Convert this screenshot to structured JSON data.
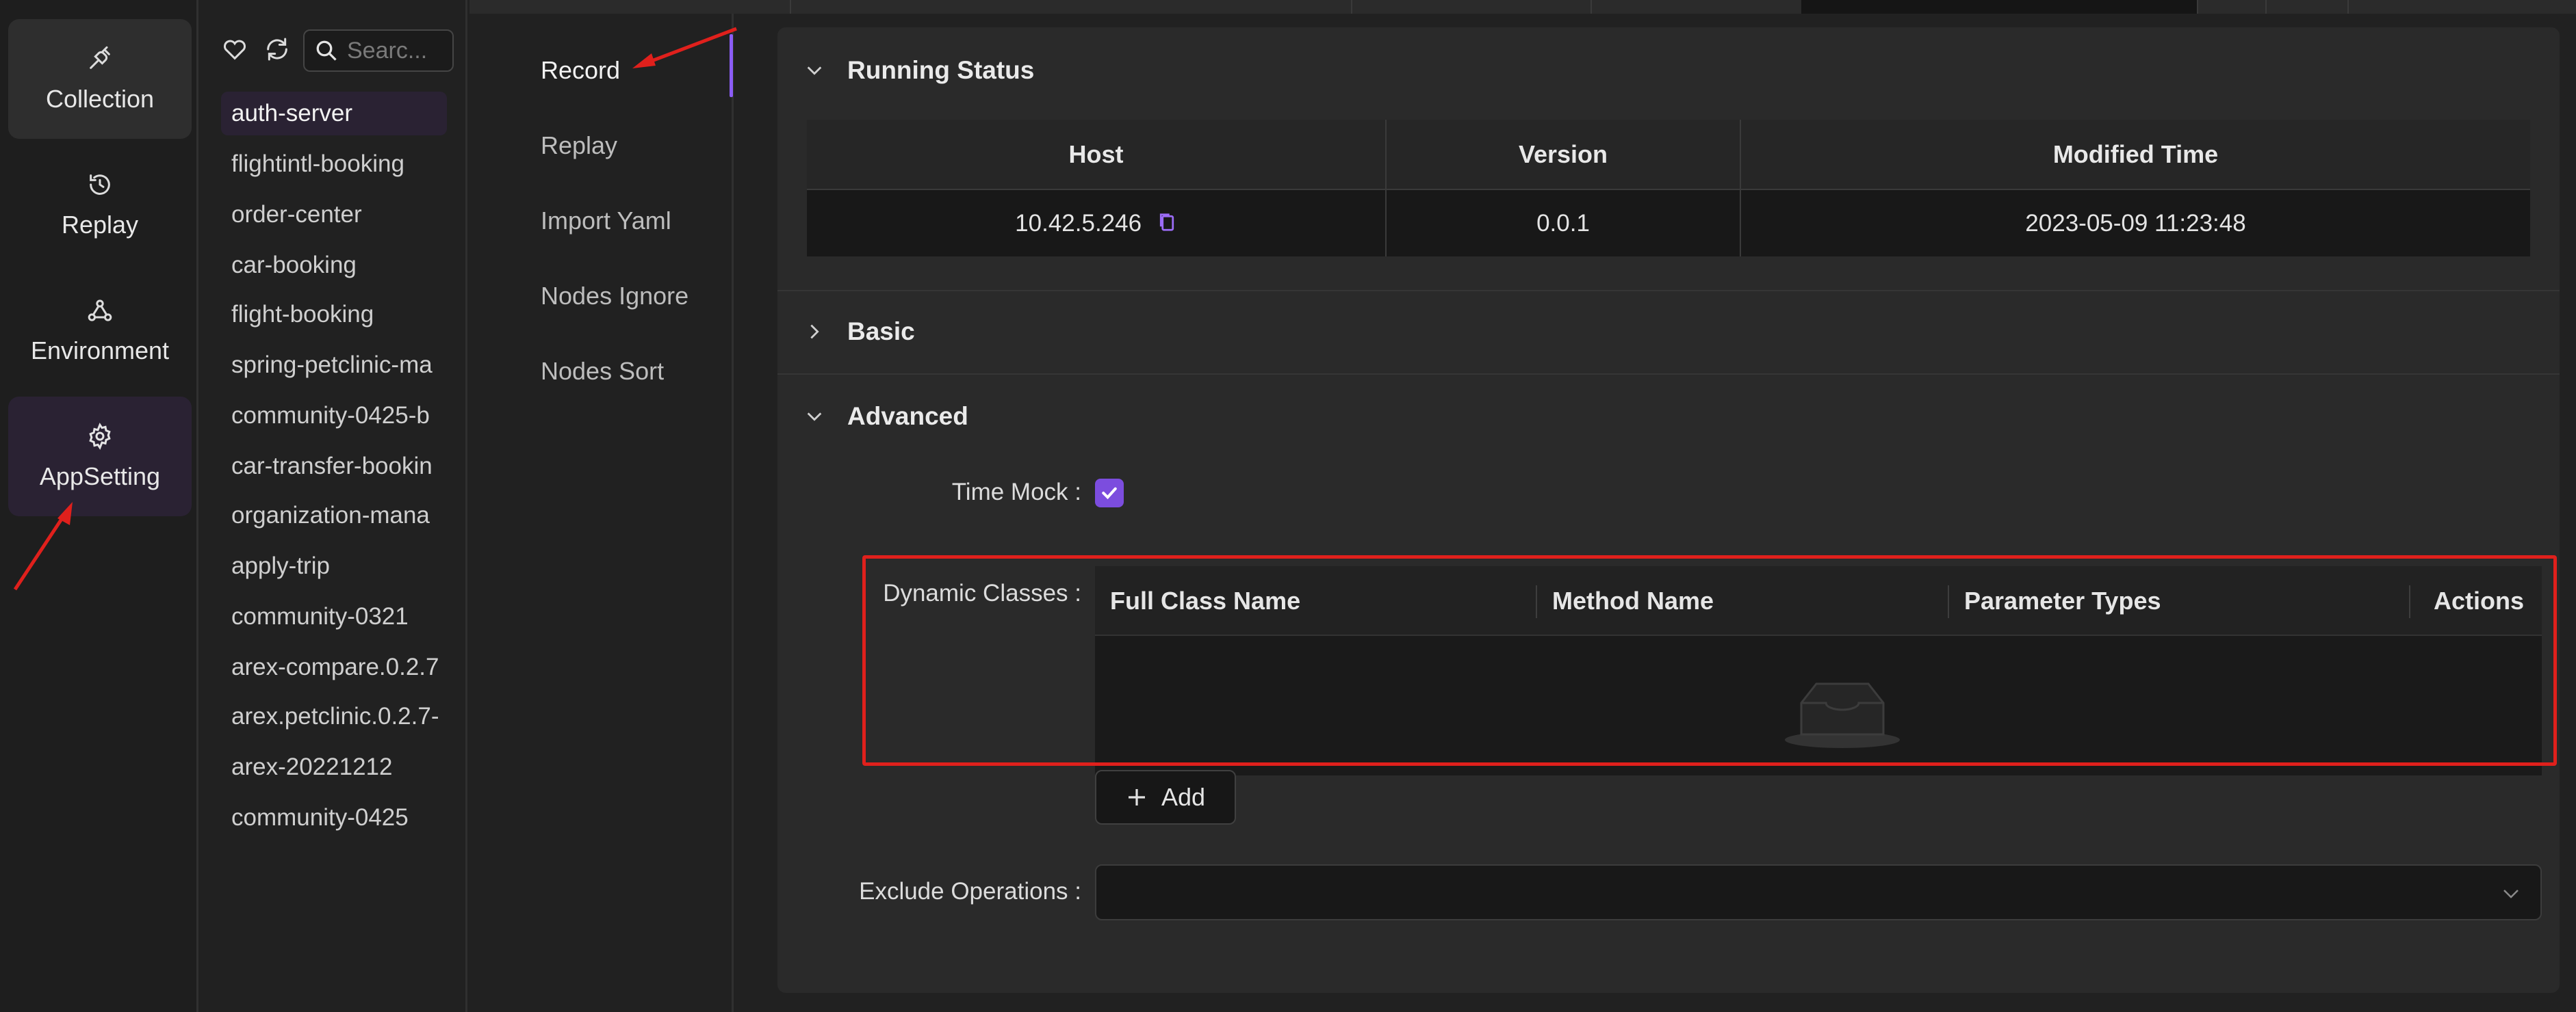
{
  "nav": {
    "items": [
      {
        "label": "Collection",
        "icon": "collection-icon"
      },
      {
        "label": "Replay",
        "icon": "replay-icon"
      },
      {
        "label": "Environment",
        "icon": "environment-icon"
      },
      {
        "label": "AppSetting",
        "icon": "gear-icon"
      }
    ]
  },
  "applist": {
    "search_placeholder": "Searc...",
    "items": [
      "auth-server",
      "flightintl-booking",
      "order-center",
      "car-booking",
      "flight-booking",
      "spring-petclinic-ma",
      "community-0425-b",
      "car-transfer-bookin",
      "organization-mana",
      "apply-trip",
      "community-0321",
      "arex-compare.0.2.7",
      "arex.petclinic.0.2.7-",
      "arex-20221212",
      "community-0425"
    ],
    "selected_index": 0
  },
  "settings_menu": {
    "items": [
      "Record",
      "Replay",
      "Import Yaml",
      "Nodes Ignore",
      "Nodes Sort"
    ],
    "selected_index": 0
  },
  "running_status": {
    "title": "Running Status",
    "columns": [
      "Host",
      "Version",
      "Modified Time"
    ],
    "row": {
      "host": "10.42.5.246",
      "version": "0.0.1",
      "modified_time": "2023-05-09 11:23:48"
    }
  },
  "basic": {
    "title": "Basic"
  },
  "advanced": {
    "title": "Advanced",
    "time_mock_label": "Time Mock",
    "time_mock_checked": true,
    "dynamic_classes_label": "Dynamic Classes",
    "dynamic_columns": [
      "Full Class Name",
      "Method Name",
      "Parameter Types",
      "Actions"
    ],
    "add_label": "Add",
    "exclude_operations_label": "Exclude Operations"
  },
  "colors": {
    "accent": "#8b5cf6",
    "highlight_box": "#e0201c",
    "selected_bg": "#2a2233"
  }
}
